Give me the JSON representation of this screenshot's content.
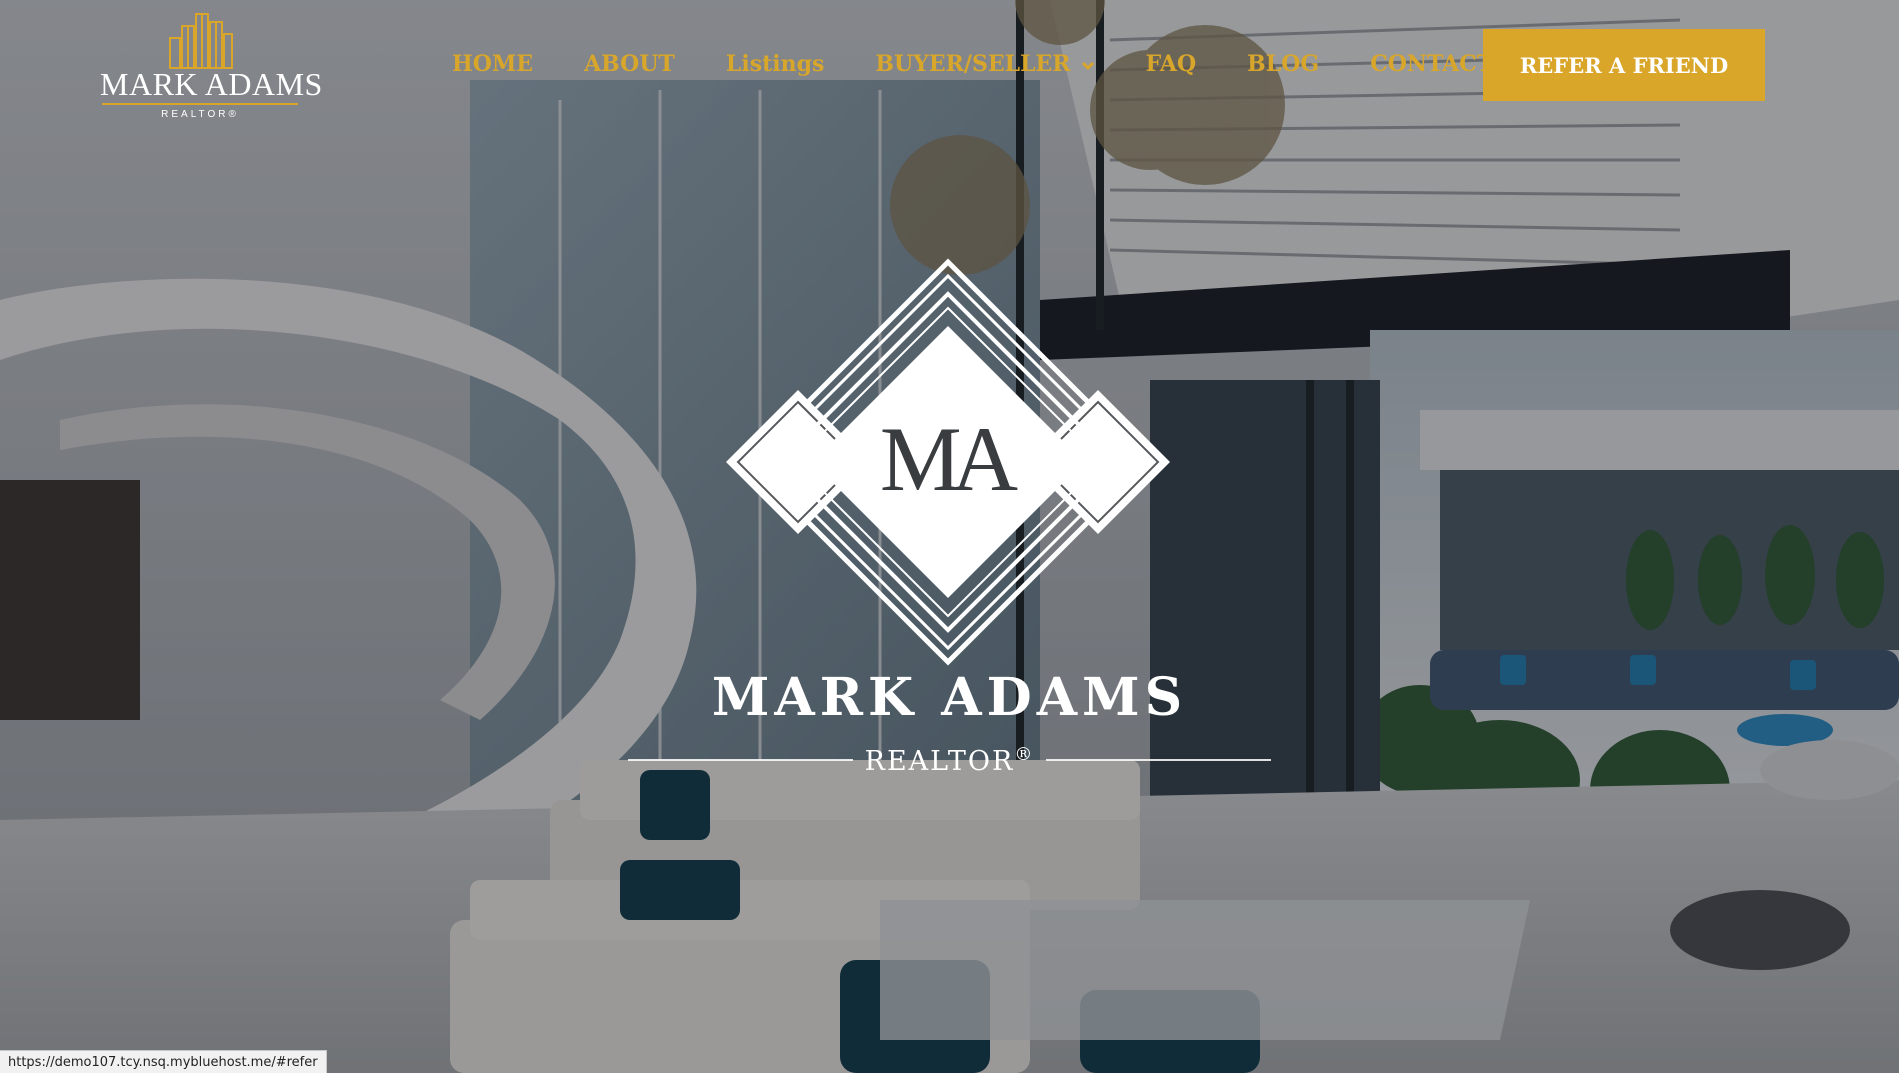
{
  "brand": {
    "name": "MARK ADAMS",
    "tagline": "REALTOR®",
    "logo_icon": "city-skyline-icon",
    "accent_color": "#d9a62a"
  },
  "nav": {
    "items": [
      {
        "label": "HOME"
      },
      {
        "label": "ABOUT"
      },
      {
        "label": "Listings"
      },
      {
        "label": "BUYER/SELLER",
        "icon": "chevron-down-icon"
      },
      {
        "label": "FAQ"
      },
      {
        "label": "BLOG"
      },
      {
        "label": "CONTACT"
      }
    ],
    "cta_label": "REFER A FRIEND"
  },
  "hero": {
    "monogram": "MA",
    "title": "MARK ADAMS",
    "subtitle": "REALTOR",
    "subtitle_mark": "®"
  },
  "status_bar": {
    "url": "https://demo107.tcy.nsq.mybluehost.me/#refer"
  }
}
